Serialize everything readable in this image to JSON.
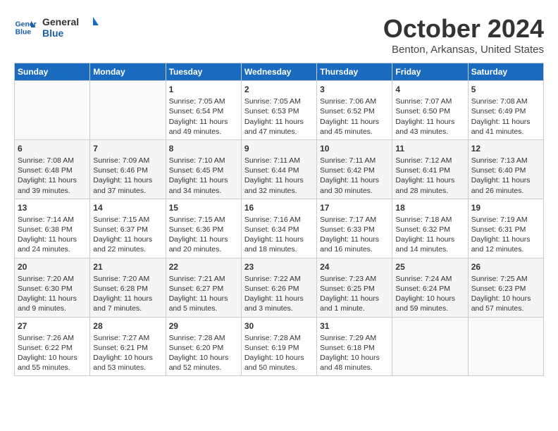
{
  "header": {
    "logo_line1": "General",
    "logo_line2": "Blue",
    "month_title": "October 2024",
    "location": "Benton, Arkansas, United States"
  },
  "days_of_week": [
    "Sunday",
    "Monday",
    "Tuesday",
    "Wednesday",
    "Thursday",
    "Friday",
    "Saturday"
  ],
  "weeks": [
    [
      {
        "day": "",
        "sunrise": "",
        "sunset": "",
        "daylight": ""
      },
      {
        "day": "",
        "sunrise": "",
        "sunset": "",
        "daylight": ""
      },
      {
        "day": "1",
        "sunrise": "Sunrise: 7:05 AM",
        "sunset": "Sunset: 6:54 PM",
        "daylight": "Daylight: 11 hours and 49 minutes."
      },
      {
        "day": "2",
        "sunrise": "Sunrise: 7:05 AM",
        "sunset": "Sunset: 6:53 PM",
        "daylight": "Daylight: 11 hours and 47 minutes."
      },
      {
        "day": "3",
        "sunrise": "Sunrise: 7:06 AM",
        "sunset": "Sunset: 6:52 PM",
        "daylight": "Daylight: 11 hours and 45 minutes."
      },
      {
        "day": "4",
        "sunrise": "Sunrise: 7:07 AM",
        "sunset": "Sunset: 6:50 PM",
        "daylight": "Daylight: 11 hours and 43 minutes."
      },
      {
        "day": "5",
        "sunrise": "Sunrise: 7:08 AM",
        "sunset": "Sunset: 6:49 PM",
        "daylight": "Daylight: 11 hours and 41 minutes."
      }
    ],
    [
      {
        "day": "6",
        "sunrise": "Sunrise: 7:08 AM",
        "sunset": "Sunset: 6:48 PM",
        "daylight": "Daylight: 11 hours and 39 minutes."
      },
      {
        "day": "7",
        "sunrise": "Sunrise: 7:09 AM",
        "sunset": "Sunset: 6:46 PM",
        "daylight": "Daylight: 11 hours and 37 minutes."
      },
      {
        "day": "8",
        "sunrise": "Sunrise: 7:10 AM",
        "sunset": "Sunset: 6:45 PM",
        "daylight": "Daylight: 11 hours and 34 minutes."
      },
      {
        "day": "9",
        "sunrise": "Sunrise: 7:11 AM",
        "sunset": "Sunset: 6:44 PM",
        "daylight": "Daylight: 11 hours and 32 minutes."
      },
      {
        "day": "10",
        "sunrise": "Sunrise: 7:11 AM",
        "sunset": "Sunset: 6:42 PM",
        "daylight": "Daylight: 11 hours and 30 minutes."
      },
      {
        "day": "11",
        "sunrise": "Sunrise: 7:12 AM",
        "sunset": "Sunset: 6:41 PM",
        "daylight": "Daylight: 11 hours and 28 minutes."
      },
      {
        "day": "12",
        "sunrise": "Sunrise: 7:13 AM",
        "sunset": "Sunset: 6:40 PM",
        "daylight": "Daylight: 11 hours and 26 minutes."
      }
    ],
    [
      {
        "day": "13",
        "sunrise": "Sunrise: 7:14 AM",
        "sunset": "Sunset: 6:38 PM",
        "daylight": "Daylight: 11 hours and 24 minutes."
      },
      {
        "day": "14",
        "sunrise": "Sunrise: 7:15 AM",
        "sunset": "Sunset: 6:37 PM",
        "daylight": "Daylight: 11 hours and 22 minutes."
      },
      {
        "day": "15",
        "sunrise": "Sunrise: 7:15 AM",
        "sunset": "Sunset: 6:36 PM",
        "daylight": "Daylight: 11 hours and 20 minutes."
      },
      {
        "day": "16",
        "sunrise": "Sunrise: 7:16 AM",
        "sunset": "Sunset: 6:34 PM",
        "daylight": "Daylight: 11 hours and 18 minutes."
      },
      {
        "day": "17",
        "sunrise": "Sunrise: 7:17 AM",
        "sunset": "Sunset: 6:33 PM",
        "daylight": "Daylight: 11 hours and 16 minutes."
      },
      {
        "day": "18",
        "sunrise": "Sunrise: 7:18 AM",
        "sunset": "Sunset: 6:32 PM",
        "daylight": "Daylight: 11 hours and 14 minutes."
      },
      {
        "day": "19",
        "sunrise": "Sunrise: 7:19 AM",
        "sunset": "Sunset: 6:31 PM",
        "daylight": "Daylight: 11 hours and 12 minutes."
      }
    ],
    [
      {
        "day": "20",
        "sunrise": "Sunrise: 7:20 AM",
        "sunset": "Sunset: 6:30 PM",
        "daylight": "Daylight: 11 hours and 9 minutes."
      },
      {
        "day": "21",
        "sunrise": "Sunrise: 7:20 AM",
        "sunset": "Sunset: 6:28 PM",
        "daylight": "Daylight: 11 hours and 7 minutes."
      },
      {
        "day": "22",
        "sunrise": "Sunrise: 7:21 AM",
        "sunset": "Sunset: 6:27 PM",
        "daylight": "Daylight: 11 hours and 5 minutes."
      },
      {
        "day": "23",
        "sunrise": "Sunrise: 7:22 AM",
        "sunset": "Sunset: 6:26 PM",
        "daylight": "Daylight: 11 hours and 3 minutes."
      },
      {
        "day": "24",
        "sunrise": "Sunrise: 7:23 AM",
        "sunset": "Sunset: 6:25 PM",
        "daylight": "Daylight: 11 hours and 1 minute."
      },
      {
        "day": "25",
        "sunrise": "Sunrise: 7:24 AM",
        "sunset": "Sunset: 6:24 PM",
        "daylight": "Daylight: 10 hours and 59 minutes."
      },
      {
        "day": "26",
        "sunrise": "Sunrise: 7:25 AM",
        "sunset": "Sunset: 6:23 PM",
        "daylight": "Daylight: 10 hours and 57 minutes."
      }
    ],
    [
      {
        "day": "27",
        "sunrise": "Sunrise: 7:26 AM",
        "sunset": "Sunset: 6:22 PM",
        "daylight": "Daylight: 10 hours and 55 minutes."
      },
      {
        "day": "28",
        "sunrise": "Sunrise: 7:27 AM",
        "sunset": "Sunset: 6:21 PM",
        "daylight": "Daylight: 10 hours and 53 minutes."
      },
      {
        "day": "29",
        "sunrise": "Sunrise: 7:28 AM",
        "sunset": "Sunset: 6:20 PM",
        "daylight": "Daylight: 10 hours and 52 minutes."
      },
      {
        "day": "30",
        "sunrise": "Sunrise: 7:28 AM",
        "sunset": "Sunset: 6:19 PM",
        "daylight": "Daylight: 10 hours and 50 minutes."
      },
      {
        "day": "31",
        "sunrise": "Sunrise: 7:29 AM",
        "sunset": "Sunset: 6:18 PM",
        "daylight": "Daylight: 10 hours and 48 minutes."
      },
      {
        "day": "",
        "sunrise": "",
        "sunset": "",
        "daylight": ""
      },
      {
        "day": "",
        "sunrise": "",
        "sunset": "",
        "daylight": ""
      }
    ]
  ]
}
